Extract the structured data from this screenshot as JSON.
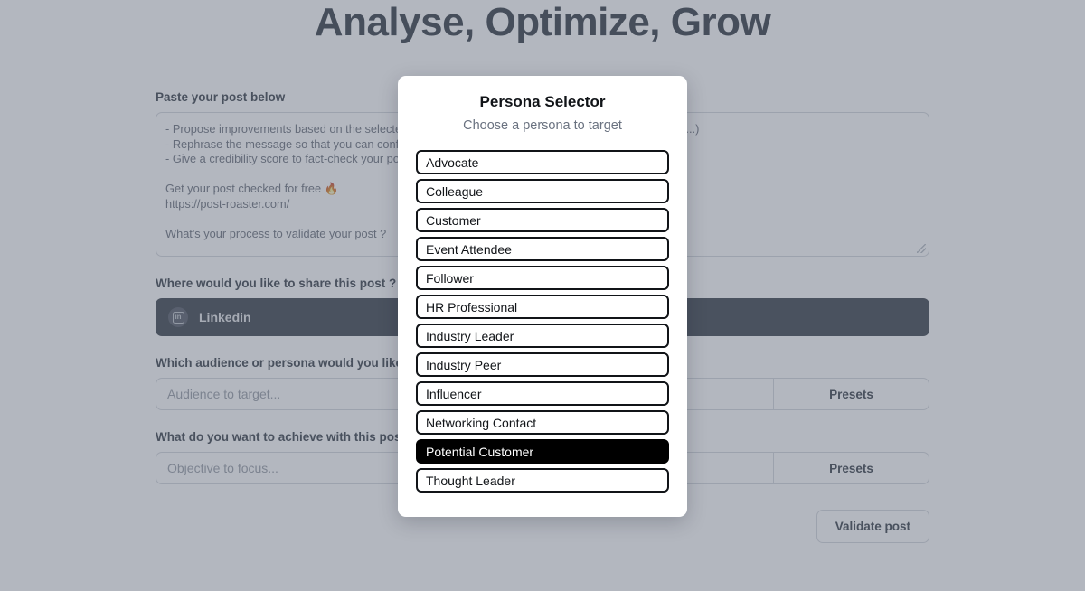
{
  "page": {
    "title": "Analyse, Optimize, Grow",
    "post_section": {
      "label": "Paste your post below",
      "textarea_value": "- Propose improvements based on the selected objective (increase followers, maximise engagement, ...)\n- Rephrase the message so that you can confirm the tone\n- Give a credibility score to fact-check your post\n\nGet your post checked for free 🔥\nhttps://post-roaster.com/\n\nWhat's your process to validate your post ?"
    },
    "platform_section": {
      "label": "Where would you like to share this post ?",
      "selected_platform": "Linkedin",
      "icon": "linkedin-icon"
    },
    "audience_section": {
      "label": "Which audience or persona would you like to target ?",
      "input_value": "",
      "input_placeholder": "Audience to target...",
      "presets_label": "Presets"
    },
    "objective_section": {
      "label": "What do you want to achieve with this post ?",
      "input_value": "",
      "input_placeholder": "Objective to focus...",
      "presets_label": "Presets"
    },
    "submit_label": "Validate post"
  },
  "modal": {
    "title": "Persona Selector",
    "subtitle": "Choose a persona to target",
    "selected": "Potential Customer",
    "items": [
      {
        "label": "Advocate",
        "selected": false
      },
      {
        "label": "Colleague",
        "selected": false
      },
      {
        "label": "Customer",
        "selected": false
      },
      {
        "label": "Event Attendee",
        "selected": false
      },
      {
        "label": "Follower",
        "selected": false
      },
      {
        "label": "HR Professional",
        "selected": false
      },
      {
        "label": "Industry Leader",
        "selected": false
      },
      {
        "label": "Industry Peer",
        "selected": false
      },
      {
        "label": "Influencer",
        "selected": false
      },
      {
        "label": "Networking Contact",
        "selected": false
      },
      {
        "label": "Potential Customer",
        "selected": true
      },
      {
        "label": "Thought Leader",
        "selected": false
      }
    ]
  },
  "colors": {
    "overlay": "#8f959f",
    "text_dark": "#37414f",
    "platform_bg": "#3f4754",
    "selected_bg": "#000000"
  }
}
